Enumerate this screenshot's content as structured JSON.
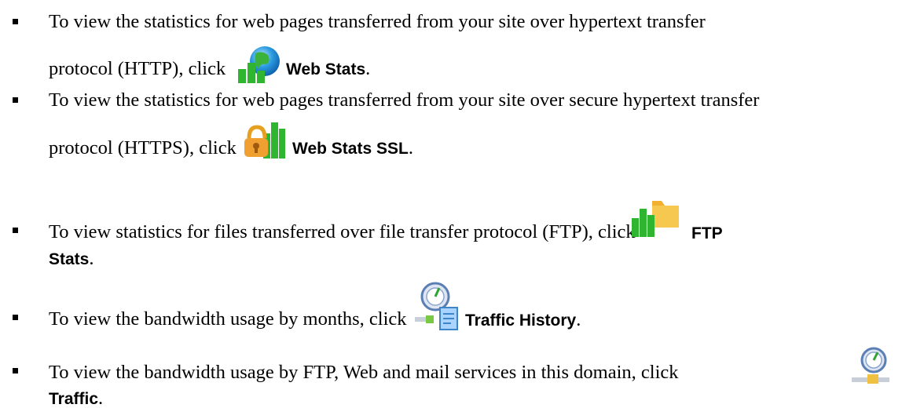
{
  "items": [
    {
      "text1": "To view the statistics for web pages transferred from your site over hypertext transfer",
      "text2": "protocol (HTTP), click",
      "label": "Web Stats",
      "icon": "web-stats-icon",
      "end": "."
    },
    {
      "text1": "To view the statistics for web pages transferred from your site over secure hypertext transfer",
      "text2": "protocol (HTTPS), click",
      "label": "Web Stats SSL",
      "icon": "web-stats-ssl-icon",
      "end": "."
    },
    {
      "text1": "To view statistics for files transferred over file transfer protocol (FTP), click",
      "label_line1": "FTP",
      "label_line2": "Stats",
      "icon": "ftp-stats-icon",
      "end": "."
    },
    {
      "text1": "To view the bandwidth usage by months, click",
      "label": "Traffic History",
      "icon": "traffic-history-icon",
      "end": "."
    },
    {
      "text1": "To view the bandwidth usage by FTP, Web and mail services in this domain, click",
      "label": "Traffic",
      "icon": "traffic-icon",
      "end": "."
    }
  ]
}
